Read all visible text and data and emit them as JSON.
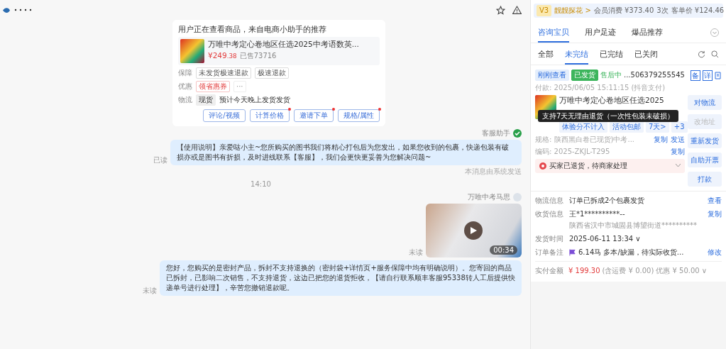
{
  "chat": {
    "recommend_card": {
      "title": "用户正在查看商品，来自电商小助手的推荐",
      "product": {
        "name": "万唯中考定心卷地区任选2025中考语数英...",
        "price": "¥249",
        "price_cents": ".38",
        "sold": "已售73716"
      },
      "rows": [
        {
          "label": "保障",
          "kind": "tags",
          "items": [
            "未发货极速退款",
            "极速退款"
          ]
        },
        {
          "label": "优惠",
          "kind": "coupon",
          "items": [
            "领省惠券",
            "···"
          ]
        },
        {
          "label": "物流",
          "kind": "text",
          "items": [
            "现货",
            "预计今天晚上发货发货"
          ]
        }
      ],
      "buttons": [
        {
          "label": "评论/视频",
          "dot": false
        },
        {
          "label": "计算价格",
          "dot": true
        },
        {
          "label": "邀请下单",
          "dot": true
        },
        {
          "label": "规格/属性",
          "dot": true
        }
      ]
    },
    "messages": [
      {
        "kind": "text",
        "sender": "客服助手",
        "status": "已读",
        "text": "【使用说明】亲爱哒小主~您所购买的图书我们将精心打包后为您发出，如果您收到的包裹，快递包装有破损亦或是图书有折损，及时进线联系【客服】，我们会更快更妥善为您解决问题~",
        "note": "本消息由系统发送"
      },
      {
        "kind": "time",
        "text": "14:10"
      },
      {
        "kind": "video",
        "sender": "万唯中考马思",
        "status": "未读",
        "duration": "00:34"
      },
      {
        "kind": "text",
        "status": "未读",
        "text": "您好，您购买的是密封产品，拆封不支持退换的（密封袋+详情页+服务保障中均有明确说明）。您寄回的商品已拆封，已影响二次销售，不支持退货，这边已把您的退货拒收，【请自行联系顺丰客服95338转人工后提供快递单号进行处理】，辛苦您撤销退款呢。"
      }
    ]
  },
  "panel": {
    "member": {
      "level": "V3",
      "name": "靓靓探花 >",
      "spend": "会员消费 ¥373.40",
      "times": "3次",
      "avg": "客单价 ¥124.46"
    },
    "tabs": [
      {
        "label": "咨询宝贝",
        "selected": true
      },
      {
        "label": "用户足迹",
        "selected": false
      },
      {
        "label": "爆品推荐",
        "selected": false
      }
    ],
    "subtabs": [
      {
        "label": "全部",
        "selected": false
      },
      {
        "label": "未完结",
        "selected": true
      },
      {
        "label": "已完结",
        "selected": false
      },
      {
        "label": "已关闭",
        "selected": false
      }
    ],
    "order": {
      "viewed": "刚刚查看",
      "shipped": "已发货",
      "after_sale": "售后中",
      "number": "...506379255545",
      "badges": [
        "备",
        "详"
      ],
      "paid": "付款: 2025/06/05 15:11:15 (抖音支付)",
      "product": {
        "title": "万唯中考定心卷地区任选2025",
        "tags": [
          "体验分不计入",
          "活动包邮",
          "7天>",
          "+3"
        ],
        "spec": "规格: 陕西黑白卷已现货)中考...",
        "code": "编码: 2025-ZKJL-T295",
        "copy": "复制",
        "send": "发送",
        "copy2": "复制"
      },
      "tooltip": "支持7天无理由退货（一次性包装未破损）",
      "alert": "买家已退货，待商家处理",
      "actions": [
        {
          "label": "对物流",
          "disabled": false
        },
        {
          "label": "改地址",
          "disabled": true
        },
        {
          "label": "重新发货",
          "disabled": false
        },
        {
          "label": "自助开票",
          "disabled": false
        },
        {
          "label": "打款",
          "disabled": false
        }
      ],
      "info": [
        {
          "label": "物流信息",
          "value": "订单已拆成2个包裹发货",
          "link": "查看"
        },
        {
          "label": "收货信息",
          "value": "王*1**********--",
          "link": "复制",
          "extra": "陕西省汉中市城固县博望街道**********"
        },
        {
          "label": "发货时间",
          "value": "2025-06-11 13:34 ∨"
        },
        {
          "label": "订单备注",
          "value": "6.14马 多本/缺漏，待实际收货...",
          "link": "修改",
          "flag": true
        }
      ],
      "total": {
        "label": "实付金额",
        "amount": "¥ 199.30",
        "freight": "(含运费 ¥ 0.00)",
        "discount": "优惠 ¥ 50.00 ∨"
      }
    }
  }
}
